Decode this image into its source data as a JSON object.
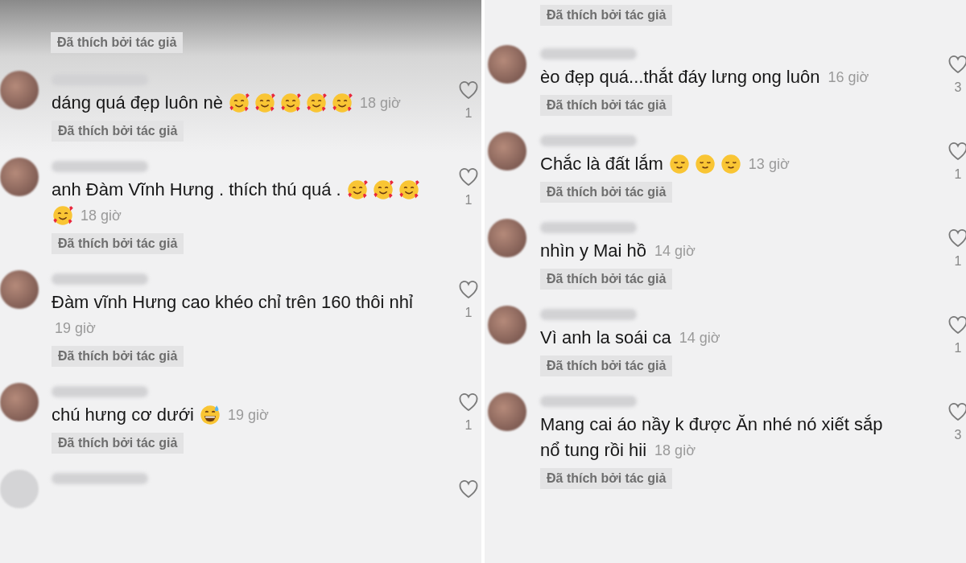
{
  "panels": [
    {
      "top_badge": "Đã thích bởi tác giả",
      "shaded_top": true,
      "trailing_partial_comment": true,
      "comments": [
        {
          "lines": [
            "dáng quá đẹp luôn nè"
          ],
          "emojis": [
            {
              "kind": "hearts"
            },
            {
              "kind": "hearts"
            },
            {
              "kind": "hearts"
            },
            {
              "kind": "hearts"
            },
            {
              "kind": "hearts"
            }
          ],
          "time": "18 giờ",
          "likes": "1",
          "badge": "Đã thích bởi tác giả"
        },
        {
          "lines": [
            "anh Đàm Vĩnh Hưng . thích thú quá ."
          ],
          "emojis": [
            {
              "kind": "hearts"
            },
            {
              "kind": "hearts"
            },
            {
              "kind": "hearts"
            },
            {
              "kind": "hearts"
            }
          ],
          "time": "18 giờ",
          "likes": "1",
          "badge": "Đã thích bởi tác giả"
        },
        {
          "lines": [
            "Đàm vĩnh Hưng cao khéo chỉ trên 160 thôi nhỉ"
          ],
          "time": "19 giờ",
          "likes": "1",
          "badge": "Đã thích bởi tác giả"
        },
        {
          "lines": [
            "chú hưng cơ dưới"
          ],
          "emojis": [
            {
              "kind": "sweat"
            }
          ],
          "time": "19 giờ",
          "likes": "1",
          "badge": "Đã thích bởi tác giả"
        }
      ]
    },
    {
      "top_badge": "Đã thích bởi tác giả",
      "shaded_top": false,
      "trailing_partial_comment": false,
      "comments": [
        {
          "lines": [
            "èo đẹp quá...thắt đáy lưng ong luôn"
          ],
          "time": "16 giờ",
          "likes": "3",
          "badge": "Đã thích bởi tác giả"
        },
        {
          "lines": [
            "Chắc là đất lắm"
          ],
          "emojis": [
            {
              "kind": "relieved"
            },
            {
              "kind": "relieved"
            },
            {
              "kind": "relieved"
            }
          ],
          "time": "13 giờ",
          "likes": "1",
          "badge": "Đã thích bởi tác giả"
        },
        {
          "lines": [
            "nhìn y Mai hồ"
          ],
          "time": "14 giờ",
          "likes": "1",
          "badge": "Đã thích bởi tác giả"
        },
        {
          "lines": [
            "Vì anh la soái ca"
          ],
          "time": "14 giờ",
          "likes": "1",
          "badge": "Đã thích bởi tác giả"
        },
        {
          "lines": [
            "Mang cai áo nầy k được Ăn nhé nó xiết sắp",
            "nổ tung rồi hii"
          ],
          "time": "18 giờ",
          "likes": "3",
          "badge": "Đã thích bởi tác giả"
        }
      ]
    }
  ]
}
